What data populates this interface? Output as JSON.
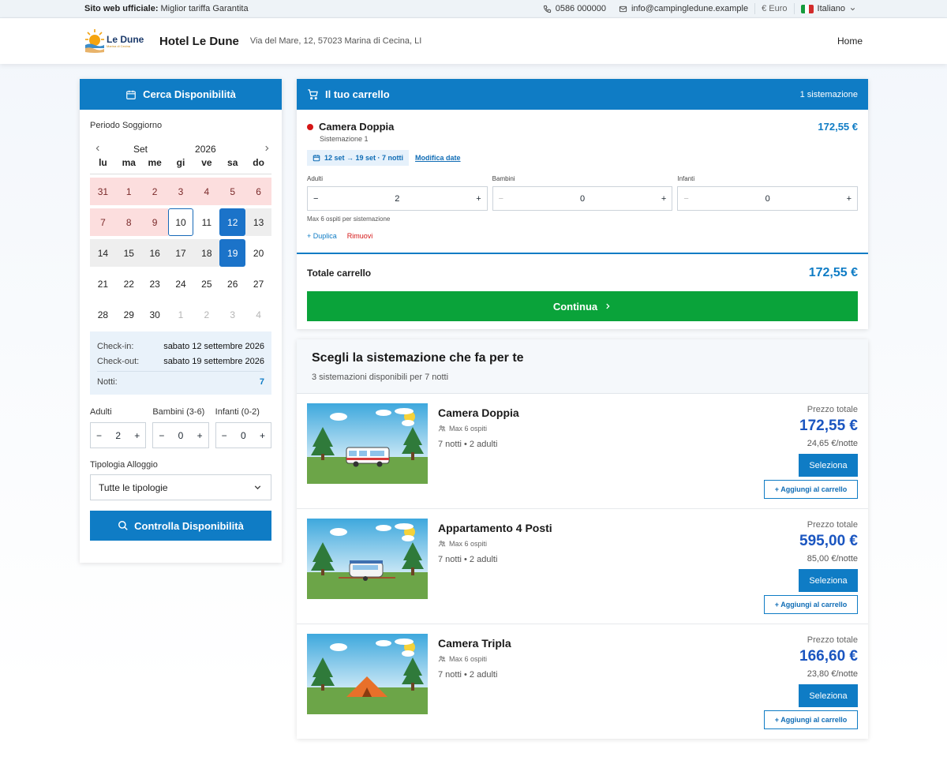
{
  "topbar": {
    "official_label": "Sito web ufficiale:",
    "official_text": "Miglior tariffa Garantita",
    "phone": "0586 000000",
    "email": "info@campingledune.example",
    "currency": "€ Euro",
    "language": "Italiano"
  },
  "header": {
    "logo_text": "Le Dune",
    "logo_subtext": "Marina di Cecina",
    "hotel_name": "Hotel Le Dune",
    "address": "Via del Mare, 12, 57023 Marina di Cecina, LI",
    "nav_home": "Home"
  },
  "search": {
    "title": "Cerca Disponibilità",
    "period_label": "Periodo Soggiorno",
    "month": "Set",
    "year": "2026",
    "weekdays": [
      "lu",
      "ma",
      "me",
      "gi",
      "ve",
      "sa",
      "do"
    ],
    "days": [
      {
        "n": "31",
        "s": "past"
      },
      {
        "n": "1",
        "s": "past"
      },
      {
        "n": "2",
        "s": "past"
      },
      {
        "n": "3",
        "s": "past"
      },
      {
        "n": "4",
        "s": "past"
      },
      {
        "n": "5",
        "s": "past"
      },
      {
        "n": "6",
        "s": "past"
      },
      {
        "n": "7",
        "s": "past"
      },
      {
        "n": "8",
        "s": "past"
      },
      {
        "n": "9",
        "s": "past"
      },
      {
        "n": "10",
        "s": "today"
      },
      {
        "n": "11",
        "s": ""
      },
      {
        "n": "12",
        "s": "sel"
      },
      {
        "n": "13",
        "s": "mid"
      },
      {
        "n": "14",
        "s": "mid"
      },
      {
        "n": "15",
        "s": "mid"
      },
      {
        "n": "16",
        "s": "mid"
      },
      {
        "n": "17",
        "s": "mid"
      },
      {
        "n": "18",
        "s": "mid"
      },
      {
        "n": "19",
        "s": "sel"
      },
      {
        "n": "20",
        "s": ""
      },
      {
        "n": "21",
        "s": ""
      },
      {
        "n": "22",
        "s": ""
      },
      {
        "n": "23",
        "s": ""
      },
      {
        "n": "24",
        "s": ""
      },
      {
        "n": "25",
        "s": ""
      },
      {
        "n": "26",
        "s": ""
      },
      {
        "n": "27",
        "s": ""
      },
      {
        "n": "28",
        "s": ""
      },
      {
        "n": "29",
        "s": ""
      },
      {
        "n": "30",
        "s": ""
      },
      {
        "n": "1",
        "s": "out"
      },
      {
        "n": "2",
        "s": "out"
      },
      {
        "n": "3",
        "s": "out"
      },
      {
        "n": "4",
        "s": "out"
      }
    ],
    "checkin_label": "Check-in:",
    "checkin_value": "sabato 12 settembre 2026",
    "checkout_label": "Check-out:",
    "checkout_value": "sabato 19 settembre 2026",
    "nights_label": "Notti:",
    "nights_value": "7",
    "adults_label": "Adulti",
    "adults_value": "2",
    "children_label": "Bambini (3-6)",
    "children_value": "0",
    "infants_label": "Infanti (0-2)",
    "infants_value": "0",
    "type_label": "Tipologia Alloggio",
    "type_value": "Tutte le tipologie",
    "check_button": "Controlla Disponibilità"
  },
  "cart": {
    "title": "Il tuo carrello",
    "count": "1 sistemazione",
    "item_name": "Camera Doppia",
    "item_price": "172,55 €",
    "item_sub": "Sistemazione 1",
    "dates_chip": "12 set → 19 set · 7 notti",
    "modify_dates": "Modifica date",
    "adults_label": "Adulti",
    "adults_value": "2",
    "children_label": "Bambini",
    "children_value": "0",
    "infants_label": "Infanti",
    "infants_value": "0",
    "max_note": "Max 6 ospiti per sistemazione",
    "duplicate": "+ Duplica",
    "remove": "Rimuovi",
    "total_label": "Totale carrello",
    "total_value": "172,55 €",
    "continue": "Continua"
  },
  "rooms": {
    "title": "Scegli la sistemazione che fa per te",
    "subtitle": "3 sistemazioni disponibili per 7 notti",
    "price_label": "Prezzo totale",
    "select_button": "Seleziona",
    "add_button": "+ Aggiungi al carrello",
    "items": [
      {
        "name": "Camera Doppia",
        "max": "Max 6 ospiti",
        "nights": "7 notti • 2 adulti",
        "price": "172,55 €",
        "per_night": "24,65 €/notte",
        "image": "camper"
      },
      {
        "name": "Appartamento 4 Posti",
        "max": "Max 6 ospiti",
        "nights": "7 notti • 2 adulti",
        "price": "595,00 €",
        "per_night": "85,00 €/notte",
        "image": "caravan"
      },
      {
        "name": "Camera Tripla",
        "max": "Max 6 ospiti",
        "nights": "7 notti • 2 adulti",
        "price": "166,60 €",
        "per_night": "23,80 €/notte",
        "image": "tent"
      }
    ]
  },
  "colors": {
    "primary": "#0f7cc5",
    "success": "#0aa33a",
    "danger": "#d51616",
    "price": "#1a55c0"
  }
}
